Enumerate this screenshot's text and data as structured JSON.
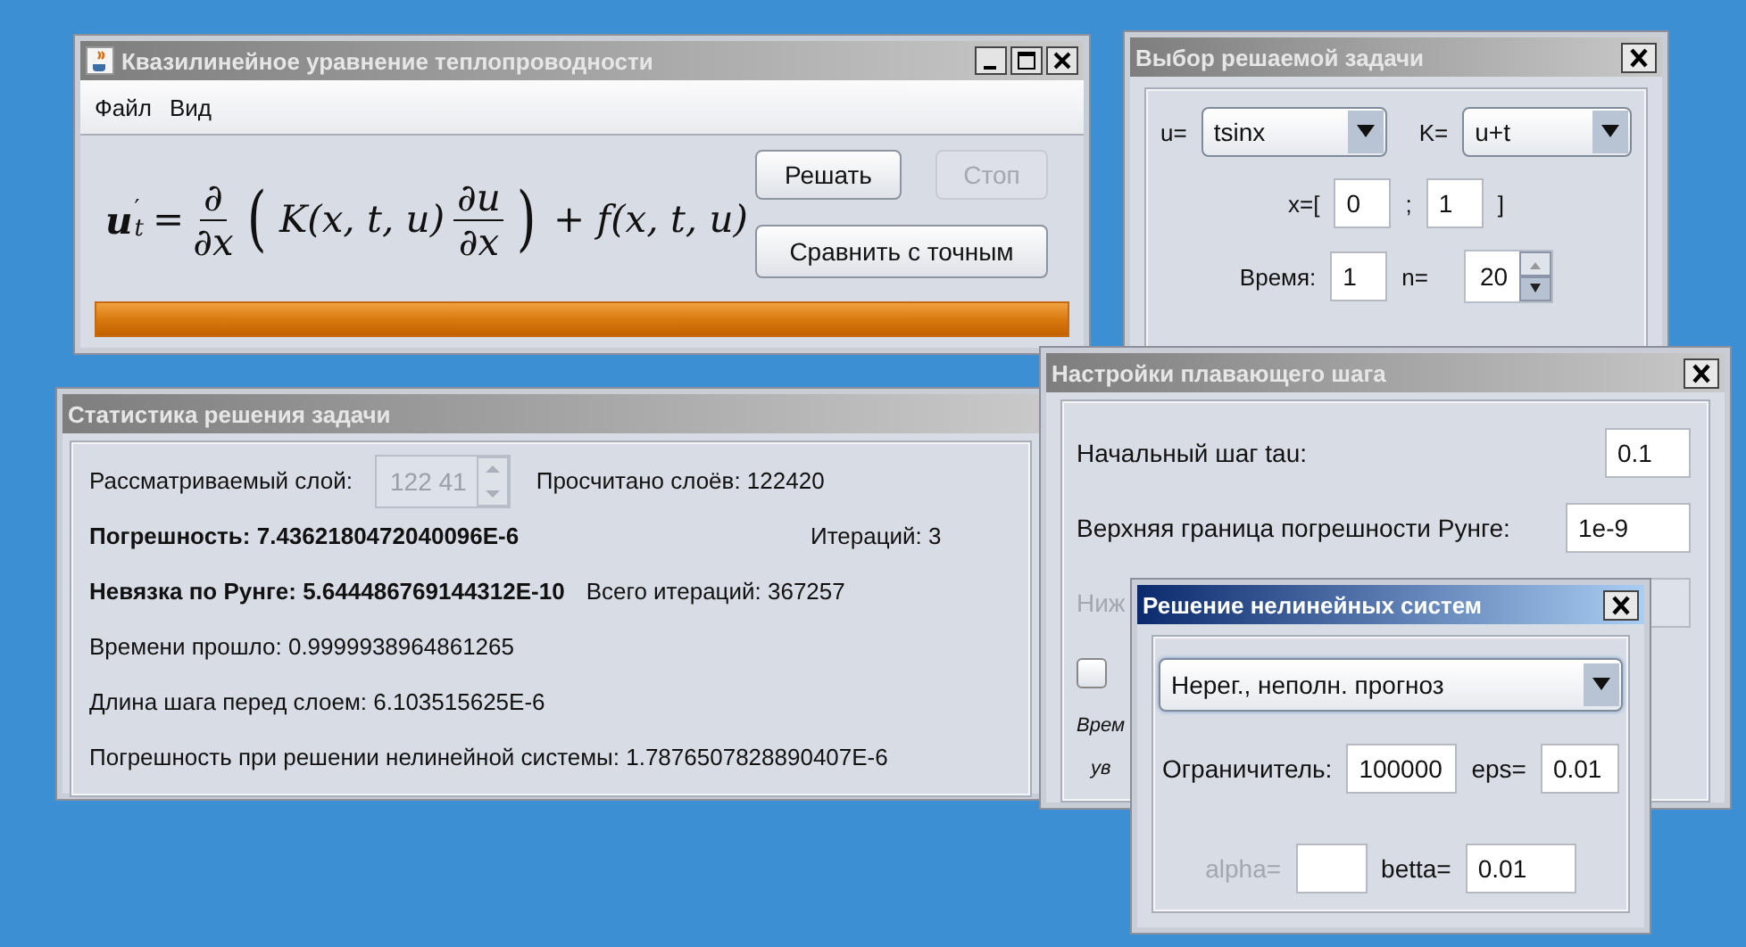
{
  "main_window": {
    "title": "Квазилинейное уравнение теплопроводности",
    "active": false,
    "menu": [
      "Файл",
      "Вид"
    ],
    "equation": {
      "var": "u",
      "prime": "′",
      "sub": "t",
      "equals": "=",
      "frac1": {
        "num": "∂",
        "den": "∂x"
      },
      "open": "(",
      "coef": "K(x, t, u)",
      "frac2": {
        "num": "∂u",
        "den": "∂x"
      },
      "close": ")",
      "source": "+ f(x, t, u)"
    },
    "buttons": [
      {
        "label": "Решать",
        "disabled": false
      },
      {
        "label": "Стоп",
        "disabled": true
      },
      {
        "label": "Сравнить с точным",
        "disabled": false
      }
    ],
    "progress": {
      "level": 1
    }
  },
  "stats_window": {
    "title": "Статистика решения задачи",
    "active": false,
    "layer_label": "Рассматриваемый слой:",
    "layer_spinner": {
      "value": "122 41",
      "disabled": true
    },
    "computed": "Просчитано слоёв: 122420",
    "error": "Погрешность: 7.4362180472040096E-6",
    "iterations": "Итераций: 3",
    "runge": "Невязка по Рунге: 5.644486769144312E-10",
    "total_iterations": "Всего итераций: 367257",
    "time_elapsed": "Времени прошло: 0.9999938964861265",
    "step_length": "Длина шага перед слоем: 6.103515625E-6",
    "nonlinear_error": "Погрешность при решении нелинейной системы: 1.7876507828890407E-6"
  },
  "task_window": {
    "title": "Выбор решаемой задачи",
    "active": false,
    "u_label": "u=",
    "u_value": "tsinx",
    "k_label": "K=",
    "k_value": "u+t",
    "x_label": "x=[",
    "x_from": "0",
    "separator": ";",
    "x_to": "1",
    "x_close": "]",
    "time_label": "Время:",
    "time_value": "1",
    "n_label": "n=",
    "n_value": "20"
  },
  "settings_window": {
    "title": "Настройки плавающего шага",
    "active": false,
    "initial_step_label": "Начальный шаг tau:",
    "initial_step": "0.1",
    "upper_label": "Верхняя граница погрешности Рунге:",
    "upper_value": "1e-9",
    "lower_label": "Ниж",
    "lower_disabled": true,
    "checkbox": {
      "checked": false
    },
    "time_label": "Врем",
    "increase_label": "ув"
  },
  "nonlinear_window": {
    "title": "Решение нелинейных систем",
    "active": true,
    "method": "Нерег., неполн. прогноз",
    "limiter_label": "Ограничитель:",
    "limiter": "100000",
    "eps_label": "eps=",
    "eps": "0.01",
    "alpha_label": "alpha=",
    "alpha_disabled": true,
    "betta_label": "betta=",
    "betta": "0.01"
  }
}
